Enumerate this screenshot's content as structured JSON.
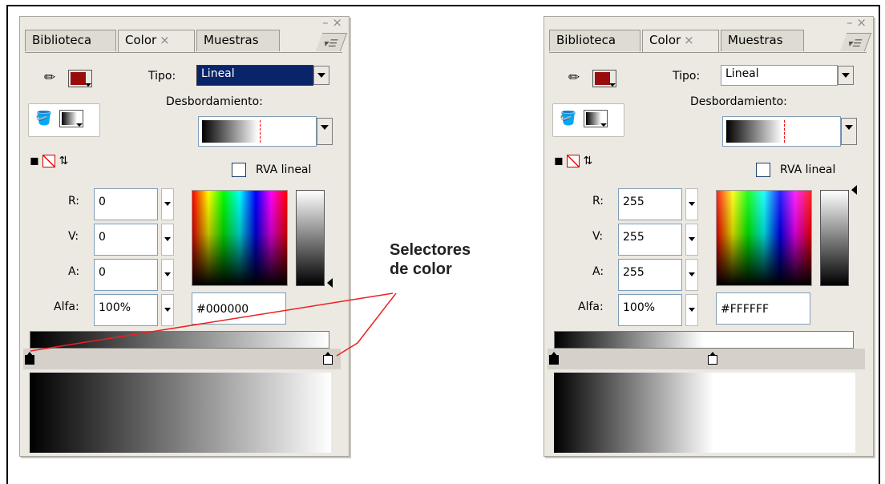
{
  "annotation": {
    "line1": "Selectores",
    "line2": "de color",
    "color": "#ee2020"
  },
  "panels": [
    {
      "tabs": {
        "library": "Biblioteca",
        "color": "Color",
        "swatches": "Muestras",
        "close_glyph": "×"
      },
      "window_controls": "– ×",
      "menu_glyph": "▾☰",
      "stroke_color": "#9a0d0d",
      "tipo_label": "Tipo:",
      "tipo_value": "Lineal",
      "tipo_focused": true,
      "overflow_label": "Desbordamiento:",
      "rgb_linear_label": "RVA lineal",
      "r_label": "R:",
      "r_value": "0",
      "g_label": "V:",
      "g_value": "0",
      "b_label": "A:",
      "b_value": "0",
      "alpha_label": "Alfa:",
      "alpha_value": "100%",
      "hex_value": "#000000",
      "gradient": {
        "start": "#000000",
        "end": "#ffffff",
        "stops": [
          0,
          1
        ]
      }
    },
    {
      "tabs": {
        "library": "Biblioteca",
        "color": "Color",
        "swatches": "Muestras",
        "close_glyph": "×"
      },
      "window_controls": "– ×",
      "menu_glyph": "▾☰",
      "stroke_color": "#9a0d0d",
      "tipo_label": "Tipo:",
      "tipo_value": "Lineal",
      "tipo_focused": false,
      "overflow_label": "Desbordamiento:",
      "rgb_linear_label": "RVA lineal",
      "r_label": "R:",
      "r_value": "255",
      "g_label": "V:",
      "g_value": "255",
      "b_label": "A:",
      "b_value": "255",
      "alpha_label": "Alfa:",
      "alpha_value": "100%",
      "hex_value": "#FFFFFF",
      "gradient": {
        "start": "#000000",
        "end": "#ffffff",
        "stops": [
          0,
          0.53
        ]
      }
    }
  ]
}
